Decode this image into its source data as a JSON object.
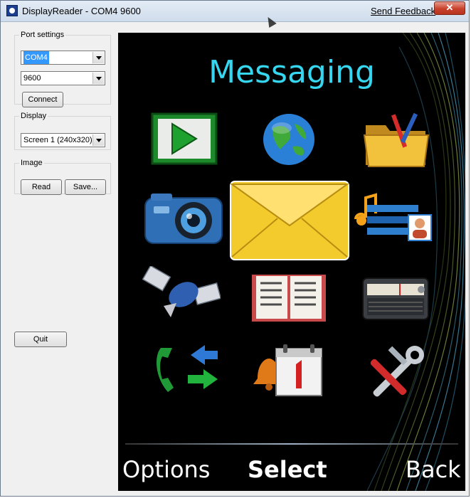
{
  "window": {
    "title": "DisplayReader - COM4 9600",
    "feedback_link": "Send Feedback",
    "close_glyph": "✕"
  },
  "port_settings": {
    "legend": "Port settings",
    "port_value": "COM4",
    "baud_value": "9600",
    "connect_label": "Connect"
  },
  "display": {
    "legend": "Display",
    "screen_value": "Screen 1 (240x320)"
  },
  "image": {
    "legend": "Image",
    "read_label": "Read",
    "save_label": "Save..."
  },
  "quit_label": "Quit",
  "phone": {
    "title": "Messaging",
    "title_color": "#36d6f0",
    "icons": [
      "media-player-icon",
      "browser-globe-icon",
      "file-manager-icon",
      "camera-icon",
      "messaging-envelope-icon",
      "contacts-music-icon",
      "satellite-icon",
      "notes-book-icon",
      "radio-icon",
      "call-log-icon",
      "calendar-icon",
      "settings-tools-icon"
    ],
    "softkeys": {
      "left": "Options",
      "center": "Select",
      "right": "Back"
    }
  }
}
